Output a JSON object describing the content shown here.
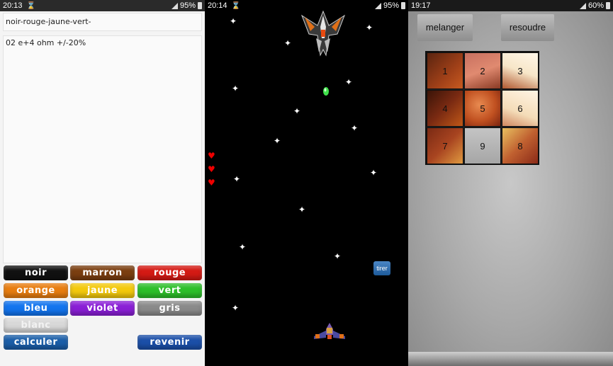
{
  "resistor_app": {
    "status": {
      "time": "20:13",
      "battery": "95%"
    },
    "colors_field": "noir-rouge-jaune-vert-",
    "result_field": "02 e+4 ohm +/-20%",
    "buttons": {
      "noir": "noir",
      "marron": "marron",
      "rouge": "rouge",
      "orange": "orange",
      "jaune": "jaune",
      "vert": "vert",
      "bleu": "bleu",
      "violet": "violet",
      "gris": "gris",
      "blanc": "blanc",
      "calculer": "calculer",
      "revenir": "revenir"
    },
    "button_colors": {
      "noir": "#111111",
      "marron": "#7a3e10",
      "rouge": "#d41a14",
      "orange": "#e87d10",
      "jaune": "#f3c90c",
      "vert": "#2dbf2a",
      "bleu": "#1274ee",
      "violet": "#8a1fd6",
      "gris": "#8a8a8a",
      "blanc": "#d8d8d8",
      "calculer": "#1b5ea8",
      "revenir": "#1b4fa8"
    }
  },
  "game_app": {
    "status": {
      "time": "20:14",
      "battery": "95%"
    },
    "lives": 3,
    "fire_button": "tirer",
    "icons": [
      "enemy-ship-icon",
      "player-ship-icon",
      "heart-icon",
      "star-icon"
    ]
  },
  "puzzle_app": {
    "status": {
      "time": "19:17",
      "battery": "60%"
    },
    "shuffle_button": "melanger",
    "solve_button": "resoudre",
    "tiles": [
      "1",
      "2",
      "3",
      "4",
      "5",
      "6",
      "7",
      "9",
      "8"
    ]
  }
}
